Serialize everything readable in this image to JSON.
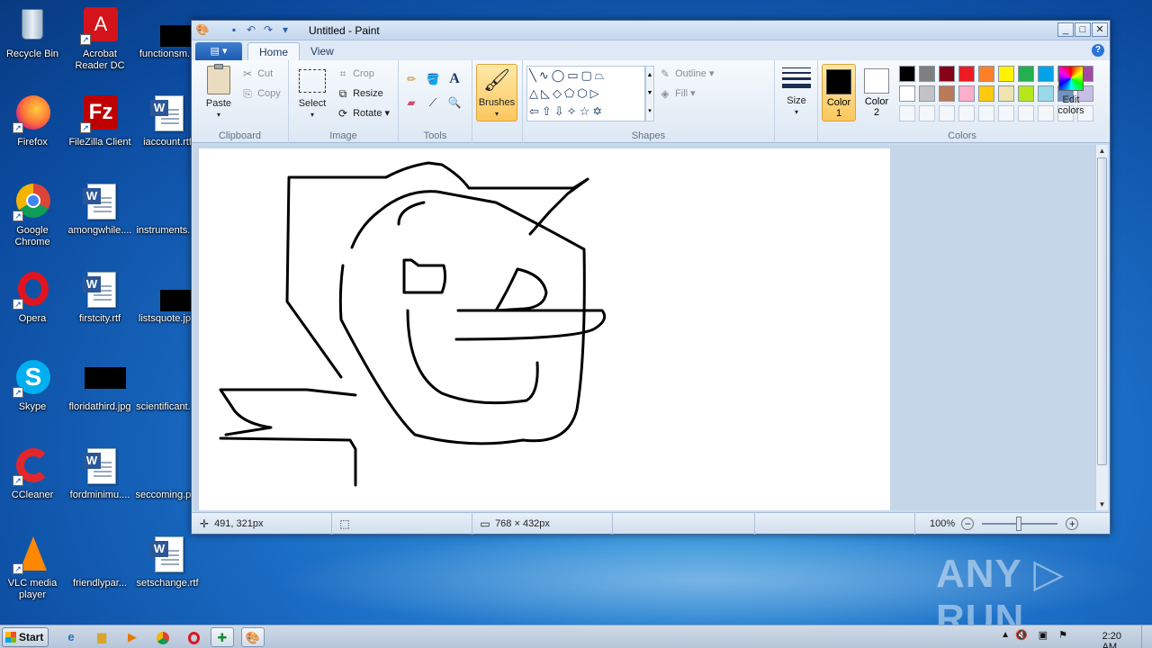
{
  "desktop": {
    "icons": [
      {
        "label": "Recycle Bin"
      },
      {
        "label": "Acrobat Reader DC"
      },
      {
        "label": "functionsm..."
      },
      {
        "label": "Firefox"
      },
      {
        "label": "FileZilla Client"
      },
      {
        "label": "iaccount.rtf"
      },
      {
        "label": "Google Chrome"
      },
      {
        "label": "amongwhile...."
      },
      {
        "label": "instruments...."
      },
      {
        "label": "Opera"
      },
      {
        "label": "firstcity.rtf"
      },
      {
        "label": "listsquote.jpg"
      },
      {
        "label": "Skype"
      },
      {
        "label": "floridathird.jpg"
      },
      {
        "label": "scientificant...."
      },
      {
        "label": "CCleaner"
      },
      {
        "label": "fordminimu...."
      },
      {
        "label": "seccoming.p..."
      },
      {
        "label": "VLC media player"
      },
      {
        "label": "friendlypar..."
      },
      {
        "label": "setschange.rtf"
      }
    ]
  },
  "window": {
    "title": "Untitled - Paint",
    "file_tab": "▤ ▾",
    "tabs": [
      "Home",
      "View"
    ],
    "help": "?",
    "controls": {
      "minimize": "_",
      "maximize": "□",
      "close": "✕"
    }
  },
  "ribbon": {
    "clipboard": {
      "label": "Clipboard",
      "paste": "Paste",
      "cut": "Cut",
      "copy": "Copy"
    },
    "image": {
      "label": "Image",
      "select": "Select",
      "crop": "Crop",
      "resize": "Resize",
      "rotate": "Rotate"
    },
    "tools": {
      "label": "Tools"
    },
    "brushes": {
      "label": "Brushes"
    },
    "shapes": {
      "label": "Shapes",
      "outline": "Outline",
      "fill": "Fill"
    },
    "size": {
      "label": "Size"
    },
    "colors": {
      "label": "Colors",
      "color1": "Color 1",
      "color2": "Color 2",
      "edit": "Edit colors",
      "color1_value": "#000000",
      "color2_value": "#ffffff",
      "row1": [
        "#000000",
        "#7f7f7f",
        "#880015",
        "#ed1c24",
        "#ff7f27",
        "#fff200",
        "#22b14c",
        "#00a2e8",
        "#3f48cc",
        "#a349a4"
      ],
      "row2": [
        "#ffffff",
        "#c3c3c3",
        "#b97a57",
        "#ffaec9",
        "#ffc90e",
        "#efe4b0",
        "#b5e61d",
        "#99d9ea",
        "#7092be",
        "#c8bfe7"
      ]
    }
  },
  "status": {
    "cursor_pos": "491, 321px",
    "canvas_size": "768 × 432px",
    "zoom": "100%"
  },
  "taskbar": {
    "start": "Start",
    "time": "2:20 AM"
  },
  "watermark": "ANY ▷ RUN"
}
